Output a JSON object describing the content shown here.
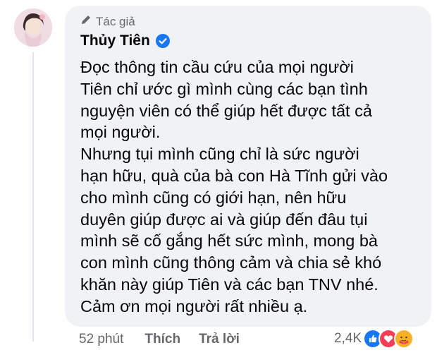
{
  "author": {
    "badge_label": "Tác giả",
    "name": "Thủy Tiên",
    "verified": true
  },
  "comment": {
    "lines": [
      "Đọc thông tin cầu cứu của mọi người",
      "Tiên chỉ ước gì mình cùng các bạn tình",
      "nguyện viên có thể giúp hết được tất cả",
      "mọi người.",
      "Nhưng tụi mình cũng chỉ là sức người",
      "hạn hữu, quà của bà con Hà Tĩnh gửi vào",
      "cho mình cũng có giới hạn, nên hữu",
      "duyên giúp được ai và giúp đến đâu tụi",
      "mình sẽ cố gắng hết sức mình, mong bà",
      "con mình cũng thông cảm và chia sẻ khó",
      "khăn này giúp Tiên và các bạn TNV nhé.",
      "Cảm ơn mọi người rất nhiều ạ."
    ]
  },
  "actions": {
    "time": "52 phút",
    "like_label": "Thích",
    "reply_label": "Trả lời"
  },
  "reactions": {
    "count": "2,4K",
    "icons": [
      "like-reaction",
      "love-reaction",
      "care-reaction"
    ]
  },
  "colors": {
    "bubble": "#f0f2f5",
    "secondary_text": "#65676b",
    "primary_text": "#050505",
    "verified_blue": "#1877f2",
    "like_blue": "#1877f2",
    "love_red": "#f33e58",
    "care_yellow": "#f7b125"
  }
}
